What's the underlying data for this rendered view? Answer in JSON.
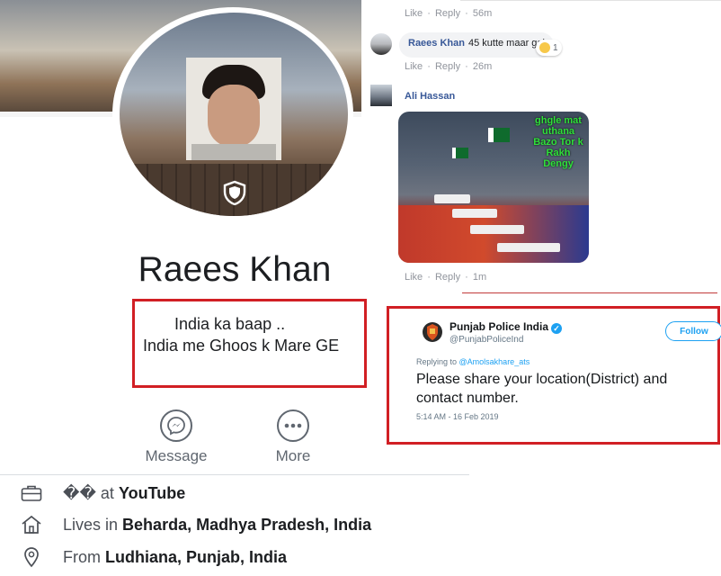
{
  "profile": {
    "name": "Raees Khan",
    "bio_line1": "India ka baap ..",
    "bio_line2": "India me Ghoos k Mare GE",
    "actions": {
      "message_label": "Message",
      "more_label": "More"
    },
    "info": {
      "work_prefix": "�� at ",
      "work_place": "YouTube",
      "lives_prefix": "Lives in ",
      "lives_place": "Beharda, Madhya Pradesh, India",
      "from_prefix": "From ",
      "from_place": "Ludhiana, Punjab, India"
    },
    "icons": [
      "shield-icon",
      "messenger-icon",
      "more-dots-icon",
      "briefcase-icon",
      "home-icon",
      "location-pin-icon"
    ]
  },
  "comments": {
    "top_meta": {
      "like": "Like",
      "sep": "·",
      "reply": "Reply",
      "time": "56m"
    },
    "comment1": {
      "author": "Raees Khan",
      "text": "45 kutte maar gai",
      "reaction_count": "1",
      "meta": {
        "like": "Like",
        "sep": "·",
        "reply": "Reply",
        "time": "26m"
      }
    },
    "comment2": {
      "author": "Ali Hassan",
      "image_caption": "ghgle mat uthana Bazo Tor k Rakh Dengy",
      "meta": {
        "like": "Like",
        "sep": "·",
        "reply": "Reply",
        "time": "1m"
      }
    }
  },
  "tweet": {
    "name": "Punjab Police India",
    "handle": "@PunjabPoliceInd",
    "follow_label": "Follow",
    "replying_prefix": "Replying to ",
    "replying_to": "@Amolsakhare_ats",
    "text": "Please share your location(District) and contact number.",
    "timestamp": "5:14 AM - 16 Feb 2019"
  },
  "colors": {
    "highlight_border": "#d11f24",
    "facebook_link": "#385898",
    "twitter_blue": "#1da1f2"
  }
}
